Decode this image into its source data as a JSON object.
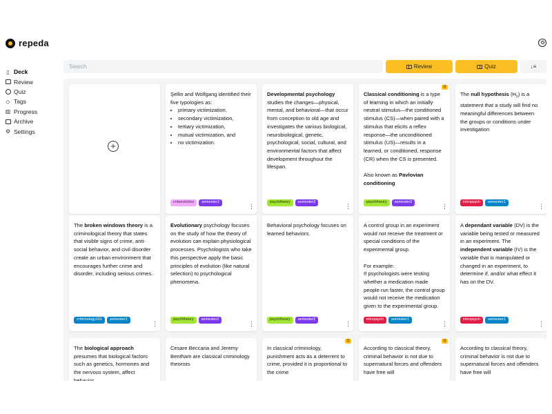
{
  "app": {
    "name": "repeda"
  },
  "sidebar": {
    "items": [
      {
        "label": "Deck"
      },
      {
        "label": "Review"
      },
      {
        "label": "Quiz"
      },
      {
        "label": "Tags"
      },
      {
        "label": "Progress"
      },
      {
        "label": "Archive"
      },
      {
        "label": "Settings"
      }
    ]
  },
  "toolbar": {
    "search_placeholder": "Search",
    "review_label": "Review",
    "quiz_label": "Quiz",
    "sort_glyph": "↓≡"
  },
  "add_card": {
    "glyph": "+"
  },
  "quiz_badge": "Q",
  "colors": {
    "accent": "#fbbf24",
    "tag_pink": "#f0abfc",
    "tag_purple": "#7c3aed",
    "tag_green": "#a3e635",
    "tag_red": "#e11d48",
    "tag_blue": "#0284c7"
  },
  "cards": [
    {
      "lines": [
        "Şellin and Wolfgang identified their five typologies as:"
      ],
      "bullets": [
        "primary victimization,",
        "secondary victimization,",
        "tertiary victimization,",
        "mutual victimization, and",
        "no victimization."
      ],
      "tags": [
        "crimevictims",
        "semester2"
      ]
    },
    {
      "title": "Developmental psychology",
      "text": " studies the changes—physical, mental, and behavioral—that occur from conception to old age and investigates the various biological, neurobiological, genetic, psychological, social, cultural, and environmental factors that affect development throughout the lifespan.",
      "tags": [
        "psychtheory",
        "semester2"
      ]
    },
    {
      "title": "Classical conditioning",
      "text": " is a type of learning in which an initially neutral stimulus—the conditioned stimulus (CS)—when paired with a stimulus that elicits a reflex response—the unconditioned stimulus (US)—results in a learned, or conditioned, response (CR) when the CS is presented.",
      "also": "Also known as ",
      "also_bold": "Pavlovian conditioning",
      "quiz": true,
      "tags": [
        "psychtheory",
        "semester2"
      ]
    },
    {
      "prefix": "The ",
      "title": "null hypothesis",
      "title_suffix": " (H",
      "sub": "0",
      "text": ") is a statement that a study will find no meaningful differences between the groups or conditions under investigation",
      "tags": [
        "intropsych",
        "semester1"
      ]
    },
    {
      "prefix": "The ",
      "title": "broken windows theory",
      "text": " is a criminological theory that states that visible signs of crime, anti-social behavior, and civil disorder create an urban environment that encourages further crime and disorder, including serious crimes.",
      "tags": [
        "criminology101",
        "semester1"
      ]
    },
    {
      "title": "Evolutionary",
      "text": " psychology focuses on the study of how the theory of evolution can explain physiological processes. Psychologists who take this perspective apply the basic principles of evolution (like natural selection) to psychological phenomena.",
      "tags": [
        "psychtheory",
        "semester2"
      ]
    },
    {
      "text": "Behavioral psychology focuses on learned behaviors.",
      "tags": [
        "psychtheory",
        "semester2"
      ]
    },
    {
      "text": "A control group in an experiment would not receive the treatment or special conditions of the experimental group.",
      "example_label": "For example:",
      "example": "If psychologists were testing whether a medication made people run faster, the control group would not receive the medication given to the experimental group.",
      "tags": [
        "intropsych",
        "semester1"
      ]
    },
    {
      "prefix": "A ",
      "title": "dependant variable",
      "text": " (DV) is the variable being tested or measured in an experiment. The ",
      "title2": "independent variable",
      "text2": " (IV) is the variable that is manipulated or changed in an experiment, to determine if, and/or what effect it has on the DV.",
      "tags": [
        "intropsych",
        "semester1"
      ]
    },
    {
      "prefix": "The ",
      "title": "biological approach",
      "text": " presumes that biological factors such as genetics, hormones and the nervous system, affect behavior."
    },
    {
      "text": "Cesare Beccaria and Jeremy Bentham are classical criminology theorists"
    },
    {
      "text": "In classical criminology, punishment acts as a deterrent to crime, provided it is proportional to the crime",
      "quiz": true
    },
    {
      "text": "According to classical theory, criminal behavior is not due to supernatural forces and offenders have free will",
      "quiz": true
    },
    {
      "text": "According to classical theory, criminal behavior is not due to supernatural forces and offenders have free will"
    }
  ]
}
